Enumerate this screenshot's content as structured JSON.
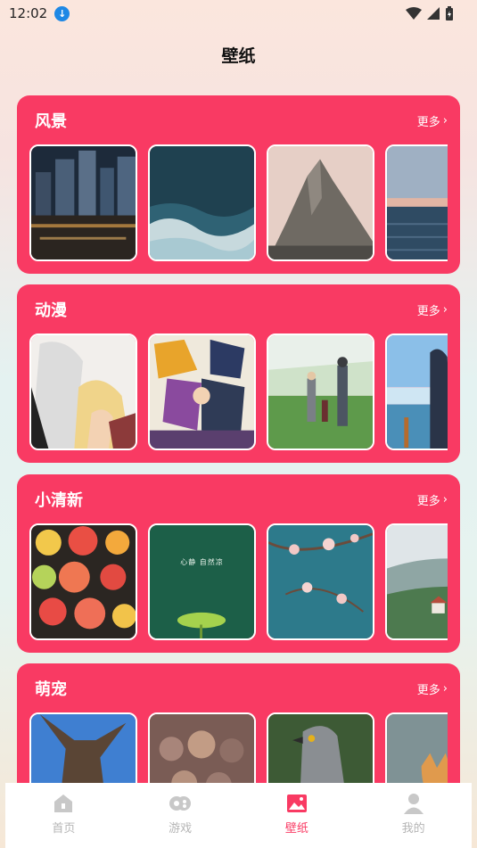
{
  "status": {
    "time": "12:02"
  },
  "page_title": "壁纸",
  "categories": [
    {
      "title": "风景",
      "more": "更多"
    },
    {
      "title": "动漫",
      "more": "更多"
    },
    {
      "title": "小清新",
      "more": "更多"
    },
    {
      "title": "萌宠",
      "more": "更多"
    }
  ],
  "thumb_text": "心静 自然凉",
  "tabs": [
    {
      "label": "首页",
      "icon": "home-icon"
    },
    {
      "label": "游戏",
      "icon": "gamepad-icon"
    },
    {
      "label": "壁纸",
      "icon": "wallpaper-icon"
    },
    {
      "label": "我的",
      "icon": "user-icon"
    }
  ],
  "colors": {
    "accent": "#f93a63",
    "tab_inactive": "#b5b5b5"
  }
}
